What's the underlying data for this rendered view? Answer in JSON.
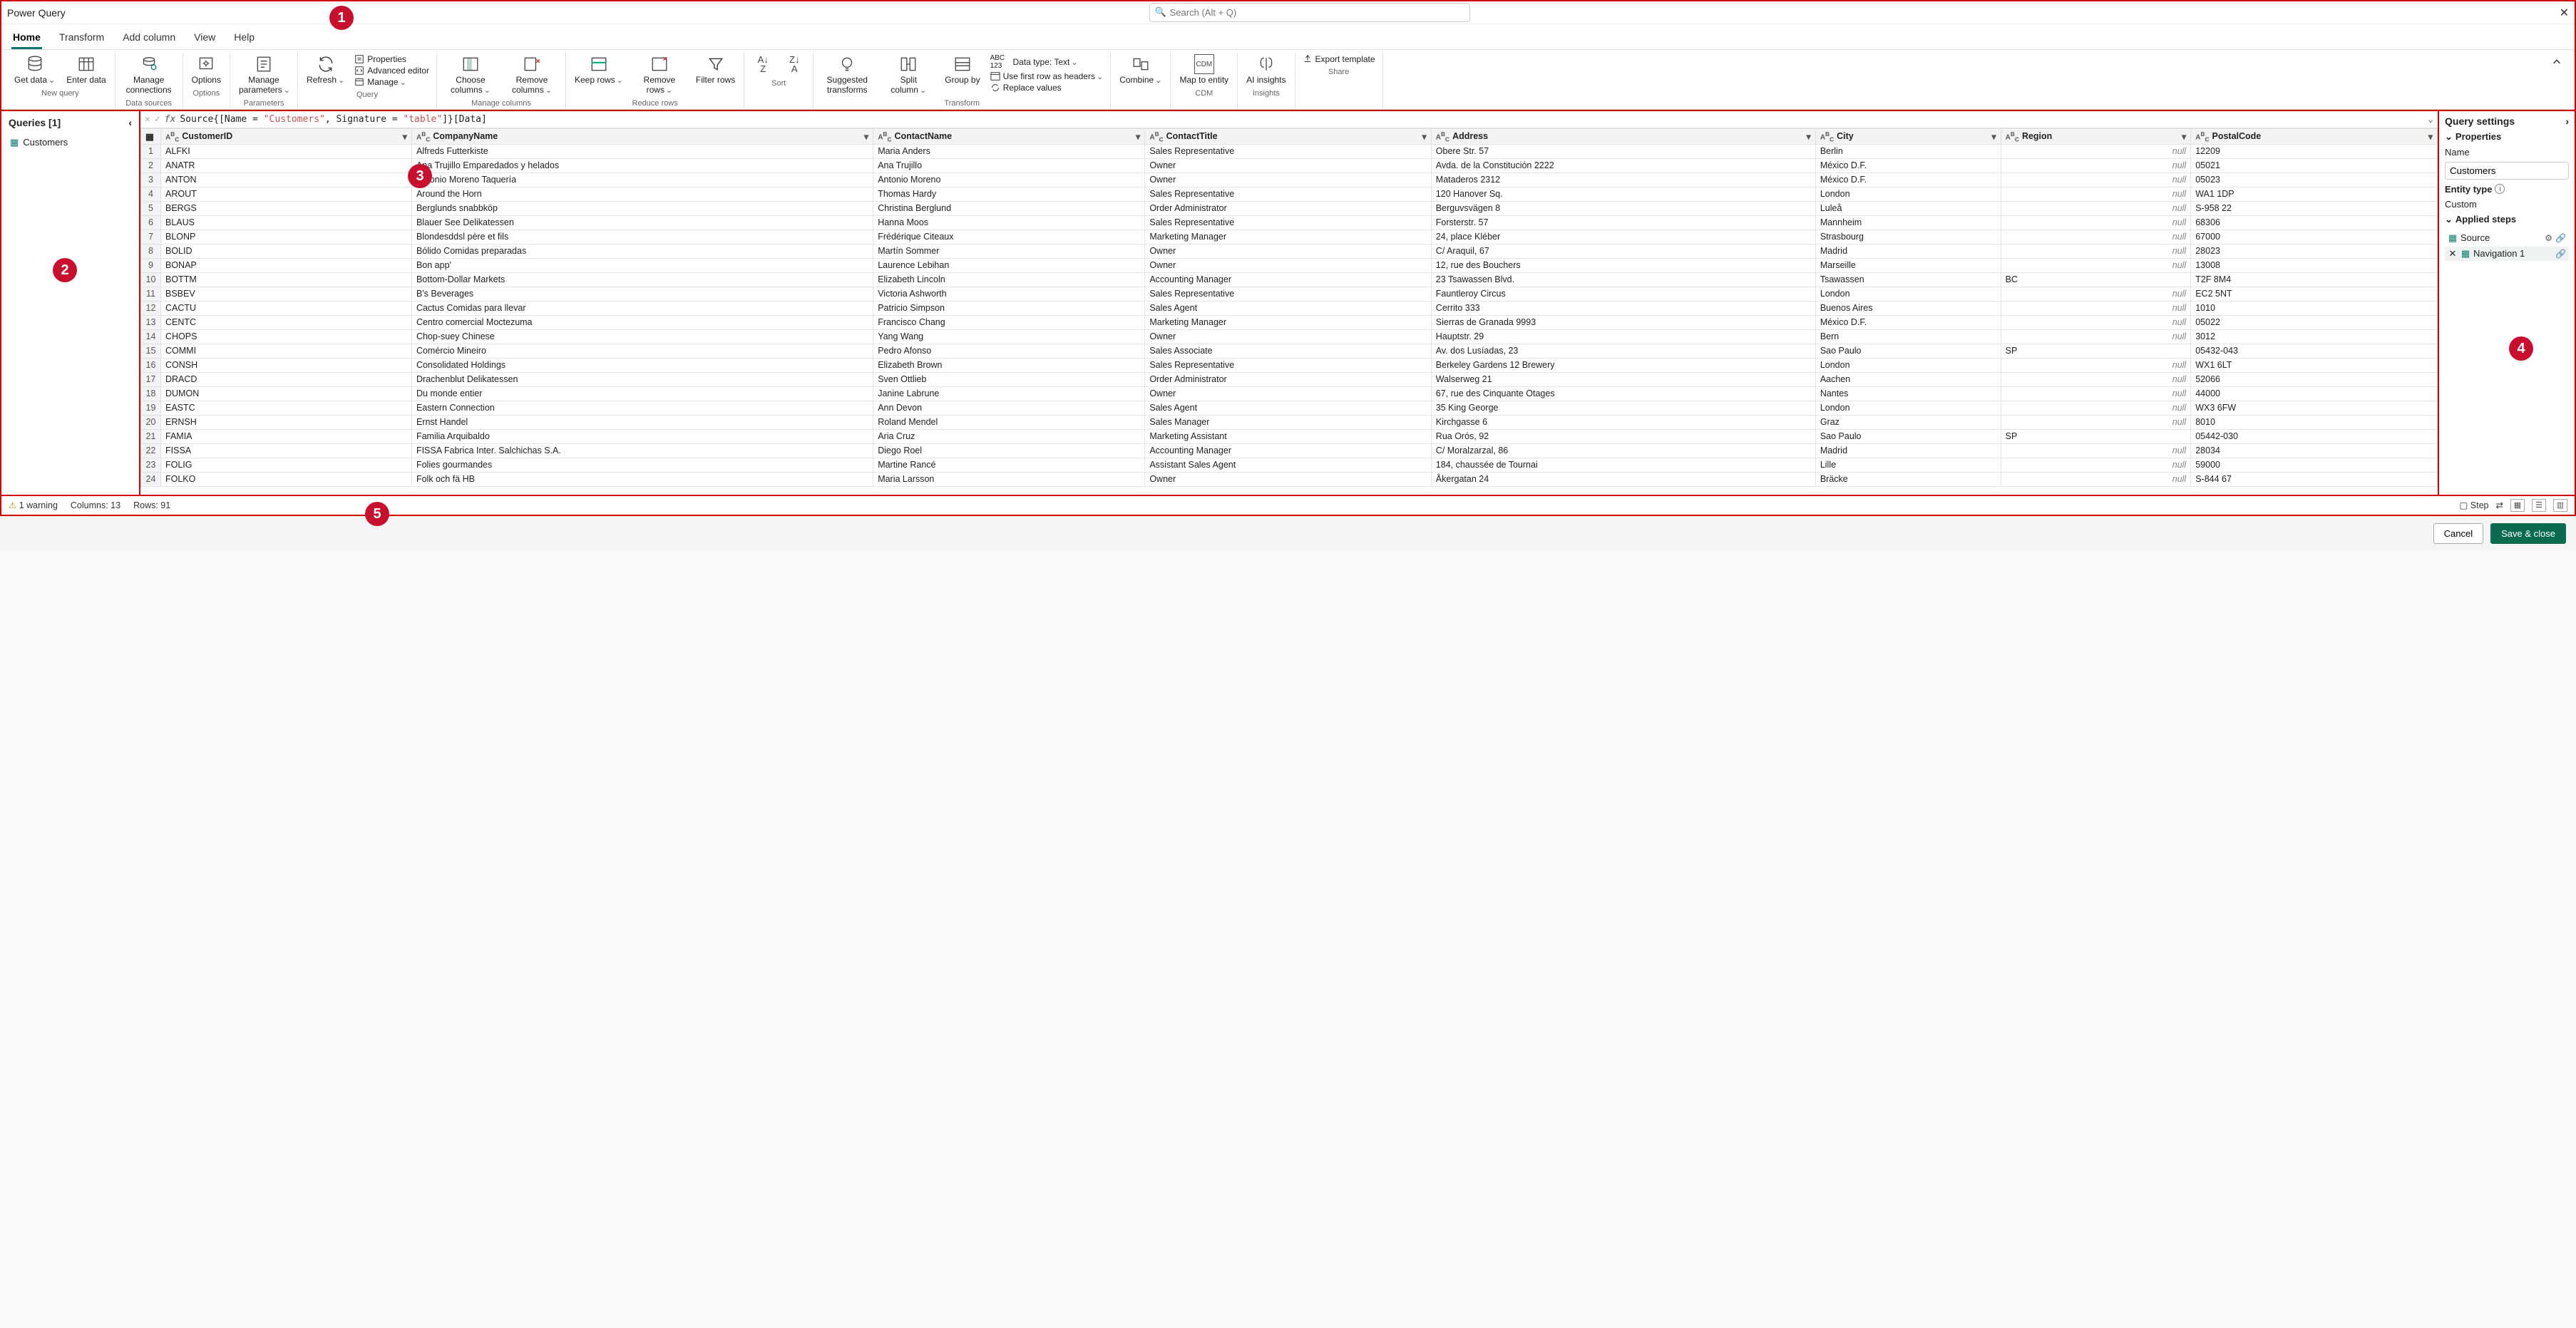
{
  "title": "Power Query",
  "search_placeholder": "Search (Alt + Q)",
  "tabs": [
    "Home",
    "Transform",
    "Add column",
    "View",
    "Help"
  ],
  "ribbon_groups": {
    "new_query": {
      "label": "New query",
      "get_data": "Get data",
      "enter_data": "Enter data"
    },
    "data_sources": {
      "label": "Data sources",
      "manage_conn": "Manage connections"
    },
    "options": {
      "label": "Options",
      "options_btn": "Options"
    },
    "parameters": {
      "label": "Parameters",
      "manage_params": "Manage parameters"
    },
    "query": {
      "label": "Query",
      "refresh": "Refresh",
      "properties": "Properties",
      "advanced": "Advanced editor",
      "manage": "Manage"
    },
    "manage_cols": {
      "label": "Manage columns",
      "choose": "Choose columns",
      "remove": "Remove columns"
    },
    "reduce_rows": {
      "label": "Reduce rows",
      "keep": "Keep rows",
      "remove": "Remove rows",
      "filter": "Filter rows"
    },
    "sort": {
      "label": "Sort"
    },
    "transform": {
      "label": "Transform",
      "suggested": "Suggested transforms",
      "split": "Split column",
      "group": "Group by",
      "data_type": "Data type: Text",
      "first_row": "Use first row as headers",
      "replace": "Replace values"
    },
    "combine": {
      "label": "Combine"
    },
    "cdm": {
      "label": "CDM",
      "map": "Map to entity"
    },
    "insights": {
      "label": "Insights",
      "ai": "AI insights"
    },
    "share": {
      "label": "Share",
      "export": "Export template"
    }
  },
  "queries_header": "Queries [1]",
  "queries": [
    "Customers"
  ],
  "formula": {
    "pre": "Source{[Name = ",
    "s1": "\"Customers\"",
    "mid": ", Signature = ",
    "s2": "\"table\"",
    "post": "]}[Data]"
  },
  "columns": [
    "CustomerID",
    "CompanyName",
    "ContactName",
    "ContactTitle",
    "Address",
    "City",
    "Region",
    "PostalCode"
  ],
  "rows": [
    [
      "ALFKI",
      "Alfreds Futterkiste",
      "Maria Anders",
      "Sales Representative",
      "Obere Str. 57",
      "Berlin",
      null,
      "12209"
    ],
    [
      "ANATR",
      "Ana Trujillo Emparedados y helados",
      "Ana Trujillo",
      "Owner",
      "Avda. de la Constitución 2222",
      "México D.F.",
      null,
      "05021"
    ],
    [
      "ANTON",
      "Antonio Moreno Taquería",
      "Antonio Moreno",
      "Owner",
      "Mataderos  2312",
      "México D.F.",
      null,
      "05023"
    ],
    [
      "AROUT",
      "Around the Horn",
      "Thomas Hardy",
      "Sales Representative",
      "120 Hanover Sq.",
      "London",
      null,
      "WA1 1DP"
    ],
    [
      "BERGS",
      "Berglunds snabbköp",
      "Christina Berglund",
      "Order Administrator",
      "Berguvsvägen  8",
      "Luleå",
      null,
      "S-958 22"
    ],
    [
      "BLAUS",
      "Blauer See Delikatessen",
      "Hanna Moos",
      "Sales Representative",
      "Forsterstr. 57",
      "Mannheim",
      null,
      "68306"
    ],
    [
      "BLONP",
      "Blondesddsl père et fils",
      "Frédérique Citeaux",
      "Marketing Manager",
      "24, place Kléber",
      "Strasbourg",
      null,
      "67000"
    ],
    [
      "BOLID",
      "Bólido Comidas preparadas",
      "Martín Sommer",
      "Owner",
      "C/ Araquil, 67",
      "Madrid",
      null,
      "28023"
    ],
    [
      "BONAP",
      "Bon app'",
      "Laurence Lebihan",
      "Owner",
      "12, rue des Bouchers",
      "Marseille",
      null,
      "13008"
    ],
    [
      "BOTTM",
      "Bottom-Dollar Markets",
      "Elizabeth Lincoln",
      "Accounting Manager",
      "23 Tsawassen Blvd.",
      "Tsawassen",
      "BC",
      "T2F 8M4"
    ],
    [
      "BSBEV",
      "B's Beverages",
      "Victoria Ashworth",
      "Sales Representative",
      "Fauntleroy Circus",
      "London",
      null,
      "EC2 5NT"
    ],
    [
      "CACTU",
      "Cactus Comidas para llevar",
      "Patricio Simpson",
      "Sales Agent",
      "Cerrito 333",
      "Buenos Aires",
      null,
      "1010"
    ],
    [
      "CENTC",
      "Centro comercial Moctezuma",
      "Francisco Chang",
      "Marketing Manager",
      "Sierras de Granada 9993",
      "México D.F.",
      null,
      "05022"
    ],
    [
      "CHOPS",
      "Chop-suey Chinese",
      "Yang Wang",
      "Owner",
      "Hauptstr. 29",
      "Bern",
      null,
      "3012"
    ],
    [
      "COMMI",
      "Comércio Mineiro",
      "Pedro Afonso",
      "Sales Associate",
      "Av. dos Lusíadas, 23",
      "Sao Paulo",
      "SP",
      "05432-043"
    ],
    [
      "CONSH",
      "Consolidated Holdings",
      "Elizabeth Brown",
      "Sales Representative",
      "Berkeley Gardens 12  Brewery",
      "London",
      null,
      "WX1 6LT"
    ],
    [
      "DRACD",
      "Drachenblut Delikatessen",
      "Sven Ottlieb",
      "Order Administrator",
      "Walserweg 21",
      "Aachen",
      null,
      "52066"
    ],
    [
      "DUMON",
      "Du monde entier",
      "Janine Labrune",
      "Owner",
      "67, rue des Cinquante Otages",
      "Nantes",
      null,
      "44000"
    ],
    [
      "EASTC",
      "Eastern Connection",
      "Ann Devon",
      "Sales Agent",
      "35 King George",
      "London",
      null,
      "WX3 6FW"
    ],
    [
      "ERNSH",
      "Ernst Handel",
      "Roland Mendel",
      "Sales Manager",
      "Kirchgasse 6",
      "Graz",
      null,
      "8010"
    ],
    [
      "FAMIA",
      "Familia Arquibaldo",
      "Aria Cruz",
      "Marketing Assistant",
      "Rua Orós, 92",
      "Sao Paulo",
      "SP",
      "05442-030"
    ],
    [
      "FISSA",
      "FISSA Fabrica Inter. Salchichas S.A.",
      "Diego Roel",
      "Accounting Manager",
      "C/ Moralzarzal, 86",
      "Madrid",
      null,
      "28034"
    ],
    [
      "FOLIG",
      "Folies gourmandes",
      "Martine Rancé",
      "Assistant Sales Agent",
      "184, chaussée de Tournai",
      "Lille",
      null,
      "59000"
    ],
    [
      "FOLKO",
      "Folk och fä HB",
      "Maria Larsson",
      "Owner",
      "Åkergatan 24",
      "Bräcke",
      null,
      "S-844 67"
    ]
  ],
  "settings": {
    "header": "Query settings",
    "properties": "Properties",
    "name_label": "Name",
    "name_value": "Customers",
    "entity_type_label": "Entity type",
    "entity_type_value": "Custom",
    "applied_steps": "Applied steps",
    "steps": [
      "Source",
      "Navigation 1"
    ]
  },
  "status": {
    "warning": "1 warning",
    "cols": "Columns: 13",
    "rows": "Rows: 91",
    "step": "Step"
  },
  "footer": {
    "cancel": "Cancel",
    "save": "Save & close"
  },
  "null_text": "null"
}
